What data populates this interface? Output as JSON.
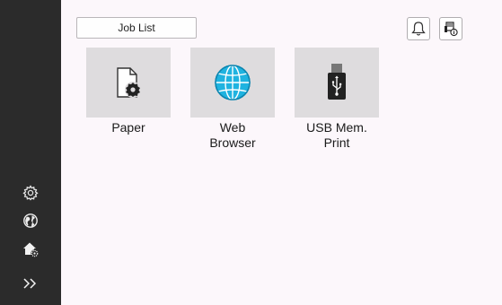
{
  "header": {
    "job_list_label": "Job List",
    "notification_icon": "bell-icon",
    "device_info_icon": "device-info-icon"
  },
  "apps": [
    {
      "label": "Paper",
      "icon": "paper-settings-icon"
    },
    {
      "label": "Web\nBrowser",
      "icon": "globe-icon"
    },
    {
      "label": "USB Mem.\nPrint",
      "icon": "usb-drive-icon"
    }
  ],
  "sidebar": {
    "items": [
      {
        "icon": "settings-gear-icon"
      },
      {
        "icon": "language-globe-icon"
      },
      {
        "icon": "home-settings-icon"
      },
      {
        "icon": "expand-chevron-icon"
      }
    ]
  },
  "colors": {
    "sidebar_bg": "#2b2b2b",
    "main_bg": "#fcf7fb",
    "tile_bg": "#dedcde",
    "globe_blue": "#1fb3e0"
  }
}
